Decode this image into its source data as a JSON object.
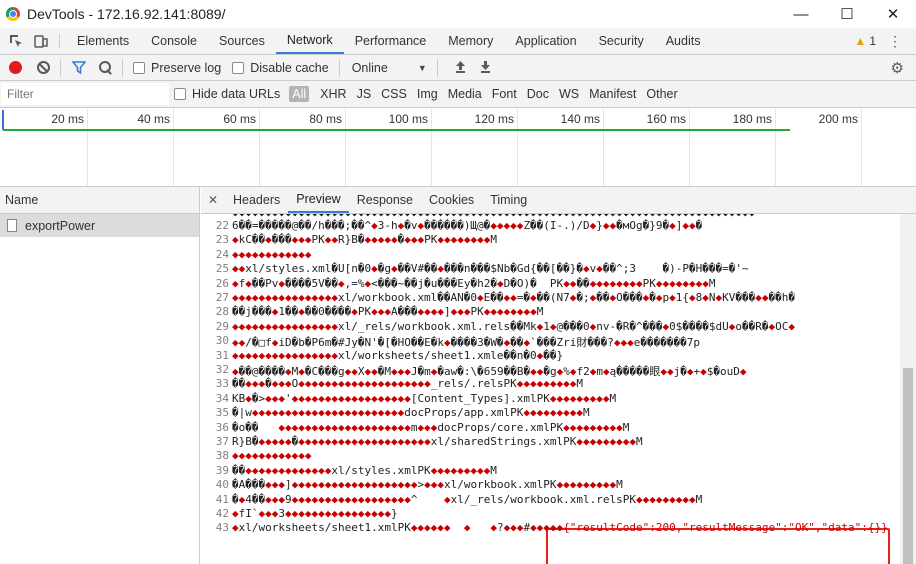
{
  "window": {
    "title": "DevTools - 172.16.92.141:8089/"
  },
  "main_tabs": [
    "Elements",
    "Console",
    "Sources",
    "Network",
    "Performance",
    "Memory",
    "Application",
    "Security",
    "Audits"
  ],
  "active_tab": "Network",
  "warnings": {
    "count": "1"
  },
  "toolbar": {
    "preserve_log": "Preserve log",
    "disable_cache": "Disable cache",
    "throttle": "Online"
  },
  "filter": {
    "placeholder": "Filter",
    "hide_data_urls": "Hide data URLs",
    "types": [
      "All",
      "XHR",
      "JS",
      "CSS",
      "Img",
      "Media",
      "Font",
      "Doc",
      "WS",
      "Manifest",
      "Other"
    ]
  },
  "timeline": {
    "ticks": [
      "20 ms",
      "40 ms",
      "60 ms",
      "80 ms",
      "100 ms",
      "120 ms",
      "140 ms",
      "160 ms",
      "180 ms",
      "200 ms"
    ]
  },
  "requests": {
    "header": "Name",
    "items": [
      "exportPower"
    ]
  },
  "detail_tabs": [
    "Headers",
    "Preview",
    "Response",
    "Cookies",
    "Timing"
  ],
  "active_detail_tab": "Preview",
  "response_lines": [
    {
      "n": "22",
      "t": "6��=�����@��/h���;��^◆3-h◆�v◆������)Щ@�◆◆◆◆◆Z��(I-.)/D◆}◆◆�мOg�}9�◆]◆◆�"
    },
    {
      "n": "23",
      "t": "◆kC��◆���◆◆◆PK◆◆R}B�◆◆◆◆◆�◆◆◆PK◆◆◆◆◆◆◆◆M"
    },
    {
      "n": "24",
      "t": "◆◆◆◆◆◆◆◆◆◆◆◆"
    },
    {
      "n": "25",
      "t": "◆◆xl/styles.xml�U[n�0◆�g◆��V#��◆���n���$Nb�Gd{��[��}�◆v◆��^;3    �)-P�H���=�'~"
    },
    {
      "n": "26",
      "t": "◆f◆��Pv◆����5V��◆,=%◆<���~��j�u���Ey�h2�◆D�O)�  PK◆◆��◆◆◆◆◆◆◆◆PK◆◆◆◆◆◆◆◆M"
    },
    {
      "n": "27",
      "t": "◆◆◆◆◆◆◆◆◆◆◆◆◆◆◆◆xl/workbook.xml��AN�0◆E��◆◆=�◆��(N7◆�;◆��◆O���◆�◆p◆1{◆8◆N◆KV���◆◆��h�"
    },
    {
      "n": "28",
      "t": "��j���◆1��◆��0����◆PK◆◆◆A���◆◆◆◆]◆◆◆PK◆◆◆◆◆◆◆◆M"
    },
    {
      "n": "29",
      "t": "◆◆◆◆◆◆◆◆◆◆◆◆◆◆◆◆xl/_rels/workbook.xml.rels��Mk◆1◆@���0◆nv-�R�^���◆0$����$dU◆o��R�◆OC◆"
    },
    {
      "n": "30",
      "t": "◆◆/�□f◆iD�b�P6m�#Jy�N'�[�HO��E�k◆����3�W�◆��◆`���Zri財���?◆◆◆e�������7p"
    },
    {
      "n": "31",
      "t": "◆◆◆◆◆◆◆◆◆◆◆◆◆◆◆◆xl/worksheets/sheet1.xmle��n�0◆��}"
    },
    {
      "n": "32",
      "t": "◆��@����◆M◆�C���g◆◆X◆◆�M◆◆◆J�m◆�aw�:\\�659��B�◆◆�g◆%◆f2◆m◆ą�����眼◆◆j�◆+◆$�ouD◆"
    },
    {
      "n": "33",
      "t": "��◆◆◆�◆◆◆O◆◆◆◆◆◆◆◆◆◆◆◆◆◆◆◆◆◆◆◆_rels/.relsPK◆◆◆◆◆◆◆◆◆M"
    },
    {
      "n": "34",
      "t": "KB◆�>◆◆◆'◆◆◆◆◆◆◆◆◆◆◆◆◆◆◆◆◆◆[Content_Types].xmlPK◆◆◆◆◆◆◆◆◆M"
    },
    {
      "n": "35",
      "t": "�|w◆◆◆◆◆◆◆◆◆◆◆◆◆◆◆◆◆◆◆◆◆◆◆docProps/app.xmlPK◆◆◆◆◆◆◆◆◆M"
    },
    {
      "n": "36",
      "t": "�o��   ◆◆◆◆◆◆◆◆◆◆◆◆◆◆◆◆◆◆◆◆m◆◆◆docProps/core.xmlPK◆◆◆◆◆◆◆◆◆M"
    },
    {
      "n": "37",
      "t": "R}B�◆◆◆◆◆�◆◆◆◆◆◆◆◆◆◆◆◆◆◆◆◆◆◆◆◆xl/sharedStrings.xmlPK◆◆◆◆◆◆◆◆◆M"
    },
    {
      "n": "38",
      "t": "◆◆◆◆◆◆◆◆◆◆◆◆"
    },
    {
      "n": "39",
      "t": "��◆◆◆◆◆◆◆◆◆◆◆◆◆xl/styles.xmlPK◆◆◆◆◆◆◆◆◆M"
    },
    {
      "n": "40",
      "t": "�A���◆◆◆]◆◆◆◆◆◆◆◆◆◆◆◆◆◆◆◆◆◆◆>◆◆◆xl/workbook.xmlPK◆◆◆◆◆◆◆◆◆M"
    },
    {
      "n": "41",
      "t": "�◆4��◆◆◆9◆◆◆◆◆◆◆◆◆◆◆◆◆◆◆◆◆◆^    ◆xl/_rels/workbook.xml.relsPK◆◆◆◆◆◆◆◆◆M"
    },
    {
      "n": "42",
      "t": "◆fI`◆◆◆3◆◆◆◆◆◆◆◆◆◆◆◆◆◆◆◆}"
    },
    {
      "n": "43",
      "t": "◆xl/worksheets/sheet1.xmlPK◆◆◆◆◆◆  ◆   ◆?◆◆◆#◆◆◆◆◆{\"resultCode\":200,\"resultMessage\":\"OK\",\"data\":{}}"
    }
  ],
  "response_json": "{\"resultCode\":200,\"resultMessage\":\"OK\",\"data\":{}}",
  "colors": {
    "accent": "#3879d9",
    "record": "#e21b1b",
    "highlight": "#e8211a",
    "waterfall": "#1eab38"
  }
}
